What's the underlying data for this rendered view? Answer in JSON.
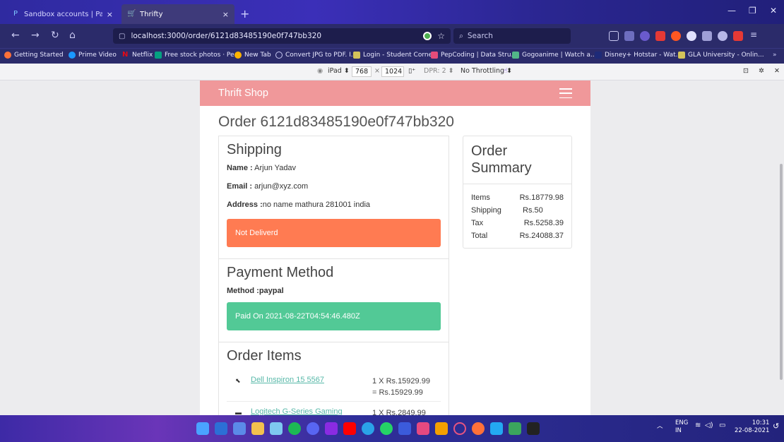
{
  "browser": {
    "tabs": [
      {
        "title": "Sandbox accounts | PayPal Dev",
        "active": false
      },
      {
        "title": "Thrifty",
        "active": true
      }
    ],
    "url": "localhost:3000/order/6121d83485190e0f747bb320",
    "search_placeholder": "Search",
    "bookmarks": [
      "Getting Started",
      "Prime Video",
      "Netflix",
      "Free stock photos · Pe...",
      "New Tab",
      "Convert JPG to PDF. I...",
      "Login - Student Corner",
      "PepCoding | Data Stru...",
      "Gogoanime | Watch a...",
      "Disney+ Hotstar - Wat...",
      "GLA University - Onlin..."
    ],
    "devtools": {
      "device": "iPad",
      "width": "768",
      "times": "×",
      "height": "1024",
      "dpr": "DPR: 2",
      "throttle": "No Throttling"
    }
  },
  "app": {
    "brand": "Thrift Shop",
    "order_title": "Order 6121d83485190e0f747bb320",
    "shipping": {
      "heading": "Shipping",
      "name_label": "Name :",
      "name": "Arjun Yadav",
      "email_label": "Email :",
      "email": "arjun@xyz.com",
      "address_label": "Address :",
      "address": "no name mathura 281001 india",
      "status": "Not Deliverd"
    },
    "payment": {
      "heading": "Payment Method",
      "method_label": "Method :",
      "method": "paypal",
      "status": "Paid On 2021-08-22T04:54:46.480Z"
    },
    "items": {
      "heading": "Order Items",
      "rows": [
        {
          "name": "Dell Inspiron 15 5567",
          "qty_price": "1 X Rs.15929.99",
          "total": "= Rs.15929.99"
        },
        {
          "name": "Logitech G-Series Gaming",
          "qty_price": "1 X Rs.2849.99",
          "total": ""
        }
      ]
    },
    "summary": {
      "heading": "Order Summary",
      "rows": [
        {
          "label": "Items",
          "value": "Rs.18779.98"
        },
        {
          "label": "Shipping",
          "value": "Rs.50"
        },
        {
          "label": "Tax",
          "value": "Rs.5258.39"
        },
        {
          "label": "Total",
          "value": "Rs.24088.37"
        }
      ]
    }
  },
  "taskbar": {
    "lang": "ENG",
    "region": "IN",
    "time": "10:31",
    "date": "22-08-2021"
  },
  "colors": {
    "navbar": "#f0989a",
    "danger": "#ff7b52",
    "success": "#52c996",
    "link": "#57b8a8"
  }
}
